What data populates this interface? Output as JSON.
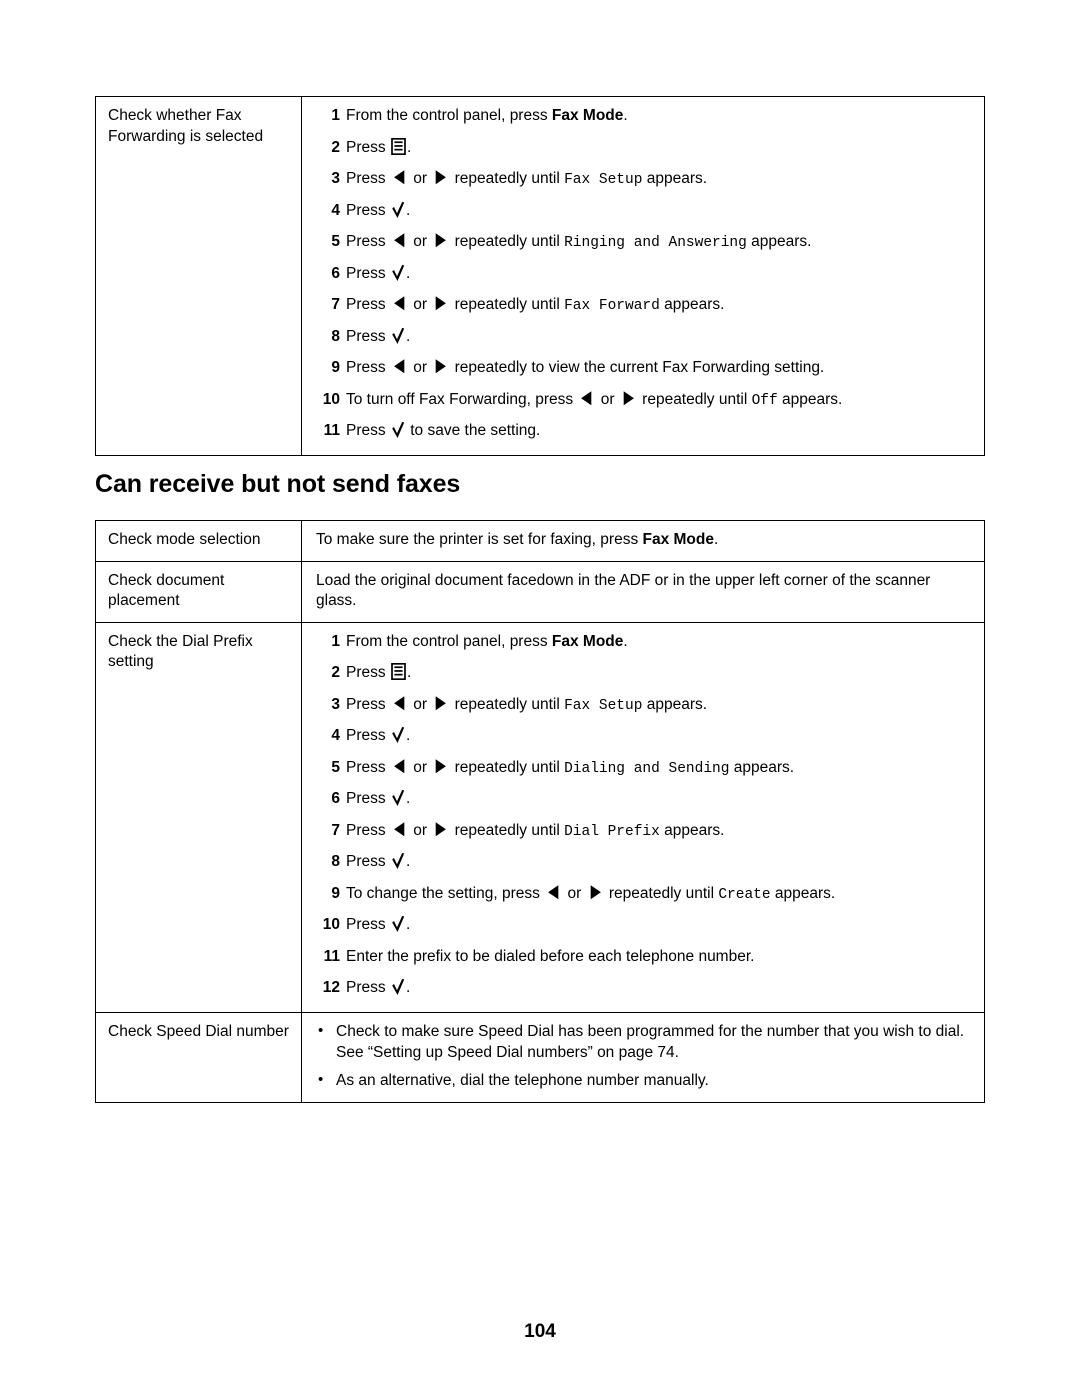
{
  "page": {
    "folio": "104",
    "heading": "Can receive but not send faxes"
  },
  "glyphs": {
    "menu_icon": "menu-icon",
    "left_arrow_icon": "left-arrow-icon",
    "right_arrow_icon": "right-arrow-icon",
    "check_icon": "check-icon",
    "bullet": "•"
  },
  "table_fax_forwarding": {
    "rows": [
      {
        "label": "Check whether Fax Forwarding is selected",
        "steps": [
          {
            "num": "1",
            "parts": [
              {
                "t": "text",
                "v": "From the control panel, press "
              },
              {
                "t": "bold",
                "v": "Fax Mode"
              },
              {
                "t": "text",
                "v": "."
              }
            ]
          },
          {
            "num": "2",
            "parts": [
              {
                "t": "text",
                "v": "Press "
              },
              {
                "t": "icon",
                "v": "menu"
              },
              {
                "t": "text",
                "v": "."
              }
            ]
          },
          {
            "num": "3",
            "parts": [
              {
                "t": "text",
                "v": "Press "
              },
              {
                "t": "icon",
                "v": "left"
              },
              {
                "t": "text",
                "v": " or "
              },
              {
                "t": "icon",
                "v": "right"
              },
              {
                "t": "text",
                "v": " repeatedly until "
              },
              {
                "t": "mono",
                "v": "Fax Setup"
              },
              {
                "t": "text",
                "v": " appears."
              }
            ]
          },
          {
            "num": "4",
            "parts": [
              {
                "t": "text",
                "v": "Press "
              },
              {
                "t": "icon",
                "v": "check"
              },
              {
                "t": "text",
                "v": "."
              }
            ]
          },
          {
            "num": "5",
            "parts": [
              {
                "t": "text",
                "v": "Press "
              },
              {
                "t": "icon",
                "v": "left"
              },
              {
                "t": "text",
                "v": " or "
              },
              {
                "t": "icon",
                "v": "right"
              },
              {
                "t": "text",
                "v": " repeatedly until "
              },
              {
                "t": "mono",
                "v": "Ringing and Answering"
              },
              {
                "t": "text",
                "v": " appears."
              }
            ]
          },
          {
            "num": "6",
            "parts": [
              {
                "t": "text",
                "v": "Press "
              },
              {
                "t": "icon",
                "v": "check"
              },
              {
                "t": "text",
                "v": "."
              }
            ]
          },
          {
            "num": "7",
            "parts": [
              {
                "t": "text",
                "v": "Press "
              },
              {
                "t": "icon",
                "v": "left"
              },
              {
                "t": "text",
                "v": " or "
              },
              {
                "t": "icon",
                "v": "right"
              },
              {
                "t": "text",
                "v": " repeatedly until "
              },
              {
                "t": "mono",
                "v": "Fax Forward"
              },
              {
                "t": "text",
                "v": " appears."
              }
            ]
          },
          {
            "num": "8",
            "parts": [
              {
                "t": "text",
                "v": "Press "
              },
              {
                "t": "icon",
                "v": "check"
              },
              {
                "t": "text",
                "v": "."
              }
            ]
          },
          {
            "num": "9",
            "parts": [
              {
                "t": "text",
                "v": "Press "
              },
              {
                "t": "icon",
                "v": "left"
              },
              {
                "t": "text",
                "v": " or "
              },
              {
                "t": "icon",
                "v": "right"
              },
              {
                "t": "text",
                "v": " repeatedly to view the current Fax Forwarding setting."
              }
            ]
          },
          {
            "num": "10",
            "parts": [
              {
                "t": "text",
                "v": "To turn off Fax Forwarding, press "
              },
              {
                "t": "icon",
                "v": "left"
              },
              {
                "t": "text",
                "v": " or "
              },
              {
                "t": "icon",
                "v": "right"
              },
              {
                "t": "text",
                "v": " repeatedly until "
              },
              {
                "t": "mono",
                "v": "Off"
              },
              {
                "t": "text",
                "v": " appears."
              }
            ]
          },
          {
            "num": "11",
            "parts": [
              {
                "t": "text",
                "v": "Press "
              },
              {
                "t": "icon",
                "v": "check"
              },
              {
                "t": "text",
                "v": " to save the setting."
              }
            ]
          }
        ]
      }
    ]
  },
  "table_cannot_send": {
    "rows": [
      {
        "label": "Check mode selection",
        "body_parts": [
          {
            "t": "text",
            "v": "To make sure the printer is set for faxing, press "
          },
          {
            "t": "bold",
            "v": "Fax Mode"
          },
          {
            "t": "text",
            "v": "."
          }
        ]
      },
      {
        "label": "Check document placement",
        "body_parts": [
          {
            "t": "text",
            "v": "Load the original document facedown in the ADF or in the upper left corner of the scanner glass."
          }
        ]
      },
      {
        "label": "Check the Dial Prefix setting",
        "steps": [
          {
            "num": "1",
            "parts": [
              {
                "t": "text",
                "v": "From the control panel, press "
              },
              {
                "t": "bold",
                "v": "Fax Mode"
              },
              {
                "t": "text",
                "v": "."
              }
            ]
          },
          {
            "num": "2",
            "parts": [
              {
                "t": "text",
                "v": "Press "
              },
              {
                "t": "icon",
                "v": "menu"
              },
              {
                "t": "text",
                "v": "."
              }
            ]
          },
          {
            "num": "3",
            "parts": [
              {
                "t": "text",
                "v": "Press "
              },
              {
                "t": "icon",
                "v": "left"
              },
              {
                "t": "text",
                "v": " or "
              },
              {
                "t": "icon",
                "v": "right"
              },
              {
                "t": "text",
                "v": " repeatedly until "
              },
              {
                "t": "mono",
                "v": "Fax Setup"
              },
              {
                "t": "text",
                "v": " appears."
              }
            ]
          },
          {
            "num": "4",
            "parts": [
              {
                "t": "text",
                "v": "Press "
              },
              {
                "t": "icon",
                "v": "check"
              },
              {
                "t": "text",
                "v": "."
              }
            ]
          },
          {
            "num": "5",
            "parts": [
              {
                "t": "text",
                "v": "Press "
              },
              {
                "t": "icon",
                "v": "left"
              },
              {
                "t": "text",
                "v": " or "
              },
              {
                "t": "icon",
                "v": "right"
              },
              {
                "t": "text",
                "v": " repeatedly until "
              },
              {
                "t": "mono",
                "v": "Dialing and Sending"
              },
              {
                "t": "text",
                "v": " appears."
              }
            ]
          },
          {
            "num": "6",
            "parts": [
              {
                "t": "text",
                "v": "Press "
              },
              {
                "t": "icon",
                "v": "check"
              },
              {
                "t": "text",
                "v": "."
              }
            ]
          },
          {
            "num": "7",
            "parts": [
              {
                "t": "text",
                "v": "Press "
              },
              {
                "t": "icon",
                "v": "left"
              },
              {
                "t": "text",
                "v": " or "
              },
              {
                "t": "icon",
                "v": "right"
              },
              {
                "t": "text",
                "v": " repeatedly until "
              },
              {
                "t": "mono",
                "v": "Dial Prefix"
              },
              {
                "t": "text",
                "v": " appears."
              }
            ]
          },
          {
            "num": "8",
            "parts": [
              {
                "t": "text",
                "v": "Press "
              },
              {
                "t": "icon",
                "v": "check"
              },
              {
                "t": "text",
                "v": "."
              }
            ]
          },
          {
            "num": "9",
            "parts": [
              {
                "t": "text",
                "v": "To change the setting, press "
              },
              {
                "t": "icon",
                "v": "left"
              },
              {
                "t": "text",
                "v": " or "
              },
              {
                "t": "icon",
                "v": "right"
              },
              {
                "t": "text",
                "v": " repeatedly until "
              },
              {
                "t": "mono",
                "v": "Create"
              },
              {
                "t": "text",
                "v": " appears."
              }
            ]
          },
          {
            "num": "10",
            "parts": [
              {
                "t": "text",
                "v": "Press "
              },
              {
                "t": "icon",
                "v": "check"
              },
              {
                "t": "text",
                "v": "."
              }
            ]
          },
          {
            "num": "11",
            "parts": [
              {
                "t": "text",
                "v": "Enter the prefix to be dialed before each telephone number."
              }
            ]
          },
          {
            "num": "12",
            "parts": [
              {
                "t": "text",
                "v": "Press "
              },
              {
                "t": "icon",
                "v": "check"
              },
              {
                "t": "text",
                "v": "."
              }
            ]
          }
        ]
      },
      {
        "label": "Check Speed Dial number",
        "bullets": [
          [
            {
              "t": "text",
              "v": "Check to make sure Speed Dial has been programmed for the number that you wish to dial. See “Setting up Speed Dial numbers” on page 74."
            }
          ],
          [
            {
              "t": "text",
              "v": "As an alternative, dial the telephone number manually."
            }
          ]
        ]
      }
    ]
  }
}
